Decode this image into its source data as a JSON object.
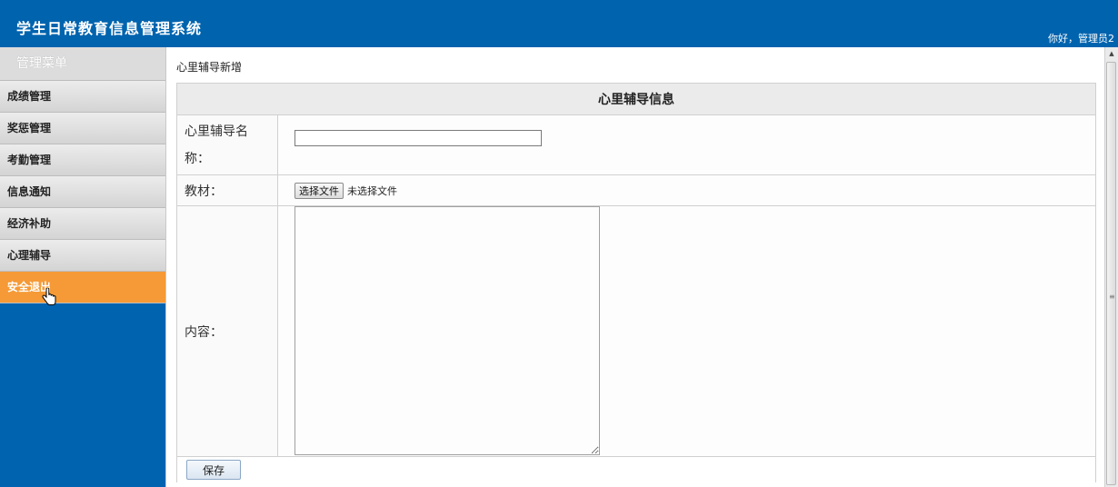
{
  "header": {
    "app_title": "学生日常教育信息管理系统",
    "welcome": "你好，管理员2"
  },
  "sidebar": {
    "menu_title": "管理菜单",
    "items": [
      {
        "label": "成绩管理"
      },
      {
        "label": "奖惩管理"
      },
      {
        "label": "考勤管理"
      },
      {
        "label": "信息通知"
      },
      {
        "label": "经济补助"
      },
      {
        "label": "心理辅导"
      },
      {
        "label": "安全退出",
        "active": true
      }
    ]
  },
  "main": {
    "breadcrumb": "心里辅导新增",
    "form_title": "心里辅导信息",
    "name_label": "心里辅导名称：",
    "name_value": "",
    "material_label": "教材：",
    "file_button": "选择文件",
    "file_status": "未选择文件",
    "content_label": "内容：",
    "content_value": "",
    "save_label": "保存"
  },
  "colors": {
    "header_bg": "#0063ae",
    "active_menu": "#f59a36"
  }
}
